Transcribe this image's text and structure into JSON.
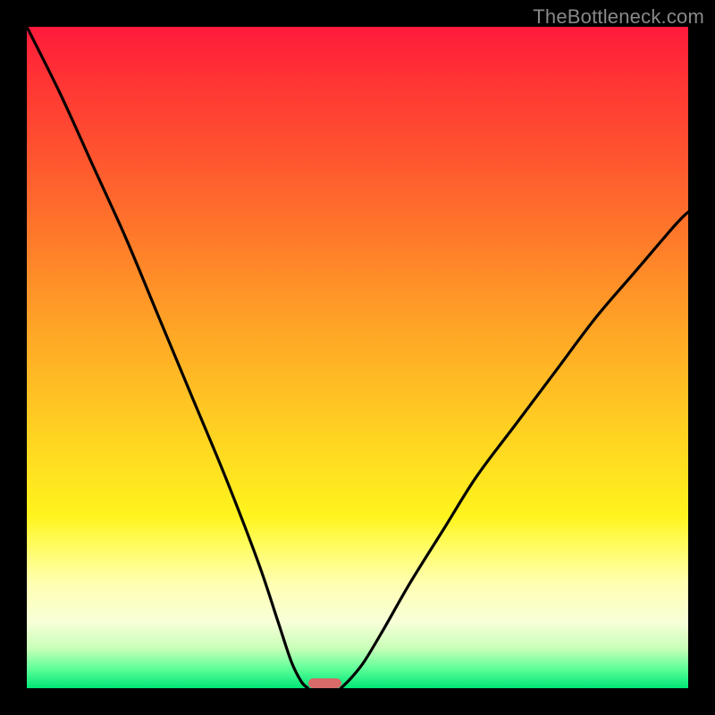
{
  "watermark": "TheBottleneck.com",
  "colors": {
    "gradient_top": "#ff1a3c",
    "gradient_bottom": "#00e676",
    "curve": "#000000",
    "marker": "#d86a6a",
    "frame": "#000000"
  },
  "chart_data": {
    "type": "line",
    "title": "",
    "xlabel": "",
    "ylabel": "",
    "xlim": [
      0,
      100
    ],
    "ylim": [
      0,
      100
    ],
    "series": [
      {
        "name": "left-curve",
        "x": [
          0,
          5,
          10,
          15,
          20,
          25,
          30,
          35,
          38,
          40,
          41.5,
          42.5
        ],
        "y": [
          100,
          90,
          79,
          68,
          56,
          44,
          32,
          19,
          10,
          4,
          1,
          0
        ]
      },
      {
        "name": "right-curve",
        "x": [
          47.5,
          49,
          51,
          54,
          58,
          63,
          68,
          74,
          80,
          86,
          92,
          98,
          100
        ],
        "y": [
          0,
          1.5,
          4,
          9,
          16,
          24,
          32,
          40,
          48,
          56,
          63,
          70,
          72
        ]
      }
    ],
    "marker": {
      "x_center": 45,
      "y": 0,
      "width_pct": 5,
      "height_pct": 1.5
    },
    "annotations": []
  }
}
